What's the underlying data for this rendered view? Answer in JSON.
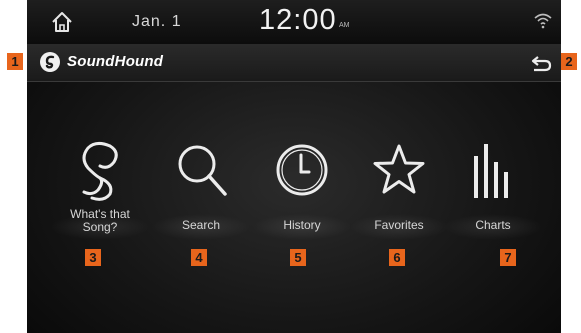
{
  "status_bar": {
    "date": "Jan.  1",
    "time": "12:00",
    "ampm": "AM",
    "home_icon": "home-icon",
    "signal_icon": "wifi-icon"
  },
  "app_bar": {
    "app_name": "SoundHound",
    "logo_icon": "soundhound-logo-icon",
    "back_icon": "back-arrow-icon"
  },
  "menu": [
    {
      "label_line1": "What's that",
      "label_line2": "Song?",
      "icon": "soundhound-icon"
    },
    {
      "label_line1": "Search",
      "label_line2": "",
      "icon": "magnifier-icon"
    },
    {
      "label_line1": "History",
      "label_line2": "",
      "icon": "clock-icon"
    },
    {
      "label_line1": "Favorites",
      "label_line2": "",
      "icon": "star-icon"
    },
    {
      "label_line1": "Charts",
      "label_line2": "",
      "icon": "bar-chart-icon"
    }
  ],
  "callouts": [
    "1",
    "2",
    "3",
    "4",
    "5",
    "6",
    "7"
  ],
  "colors": {
    "callout": "#e8651c",
    "background": "#161616",
    "label_text": "#d6d6d6"
  }
}
